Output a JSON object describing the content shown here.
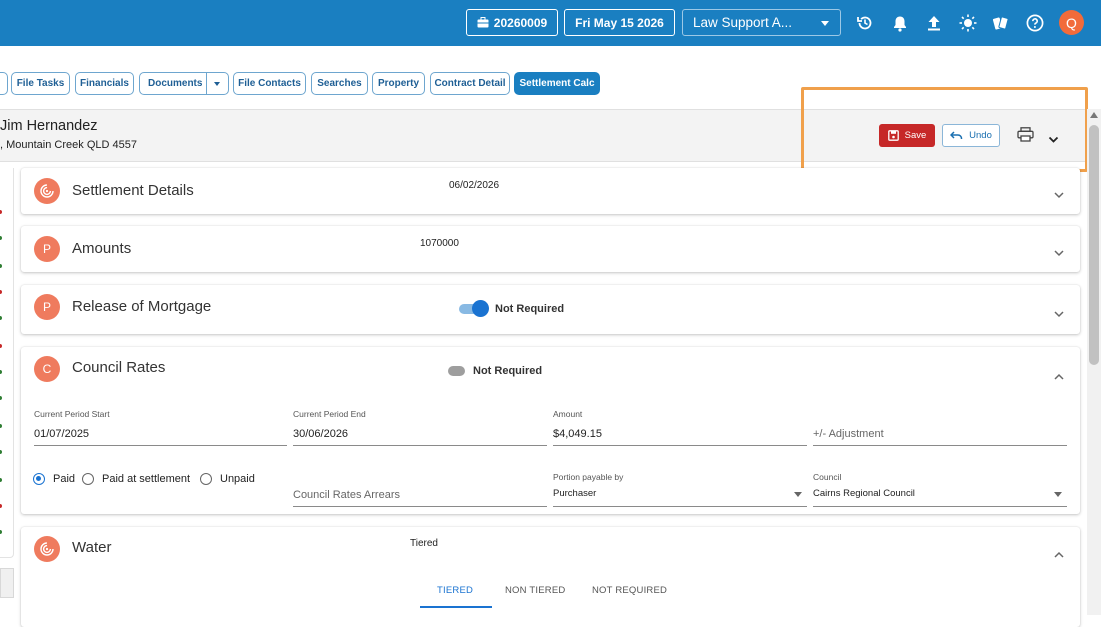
{
  "topbar": {
    "file_number": "20260009",
    "date": "Fri May 15 2026",
    "firm_select": "Law Support A...",
    "avatar_initial": "Q",
    "icons": [
      "history-icon",
      "bell-icon",
      "upload-icon",
      "brightness-icon",
      "cards-icon",
      "help-icon"
    ]
  },
  "tabs": {
    "file_tasks": "File Tasks",
    "financials": "Financials",
    "documents": "Documents",
    "file_contacts": "File Contacts",
    "searches": "Searches",
    "property": "Property",
    "contract_detail": "Contract Detail",
    "settlement_calc": "Settlement Calc"
  },
  "header": {
    "client_name": "Jim Hernandez",
    "client_address": ", Mountain Creek QLD 4557",
    "save_label": "Save",
    "undo_label": "Undo"
  },
  "sections": {
    "settlement_details": {
      "title": "Settlement Details",
      "value": "06/02/2026"
    },
    "amounts": {
      "badge": "P",
      "title": "Amounts",
      "value": "1070000"
    },
    "release_of_mortgage": {
      "badge": "P",
      "title": "Release of Mortgage",
      "toggle_label": "Not Required",
      "toggle_on": true
    },
    "council_rates": {
      "badge": "C",
      "title": "Council Rates",
      "toggle_label": "Not Required",
      "toggle_on": false,
      "period_start_label": "Current Period Start",
      "period_start": "01/07/2025",
      "period_end_label": "Current Period End",
      "period_end": "30/06/2026",
      "amount_label": "Amount",
      "amount": "$4,049.15",
      "adjustment_placeholder": "+/- Adjustment",
      "radio_paid": "Paid",
      "radio_paid_at_settlement": "Paid at settlement",
      "radio_unpaid": "Unpaid",
      "selected_radio": "Paid",
      "arrears_placeholder": "Council Rates Arrears",
      "portion_label": "Portion payable by",
      "portion_value": "Purchaser",
      "council_label": "Council",
      "council_value": "Cairns Regional Council"
    },
    "water": {
      "title": "Water",
      "value": "Tiered",
      "tabs": [
        "TIERED",
        "NON TIERED",
        "NOT REQUIRED"
      ],
      "active_tab": "TIERED"
    }
  },
  "colors": {
    "topbar": "#1a7fc1",
    "save": "#c62828",
    "highlight": "#f0a04b",
    "badge": "#ef7b5e",
    "accent": "#1a73d1"
  }
}
